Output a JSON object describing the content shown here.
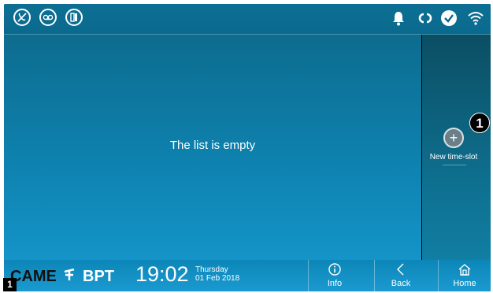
{
  "main": {
    "empty_message": "The list is empty"
  },
  "side": {
    "add_label": "New time-slot",
    "add_symbol": "+"
  },
  "callout": {
    "number": "1"
  },
  "corner": {
    "number": "1"
  },
  "bottom": {
    "brand_left": "CAME",
    "brand_right": "BPT",
    "time": "19:02",
    "weekday": "Thursday",
    "date": "01 Feb 2018",
    "info_label": "Info",
    "back_label": "Back",
    "home_label": "Home"
  },
  "topbar_icons": [
    "mute-icon",
    "voicemail-icon",
    "door-status-icon"
  ],
  "status_icons": [
    "bell-icon",
    "link-icon",
    "check-icon",
    "wifi-icon"
  ],
  "colors": {
    "accent": "#1494c8",
    "side_panel": "#0b4e63",
    "text": "#ffffff"
  }
}
